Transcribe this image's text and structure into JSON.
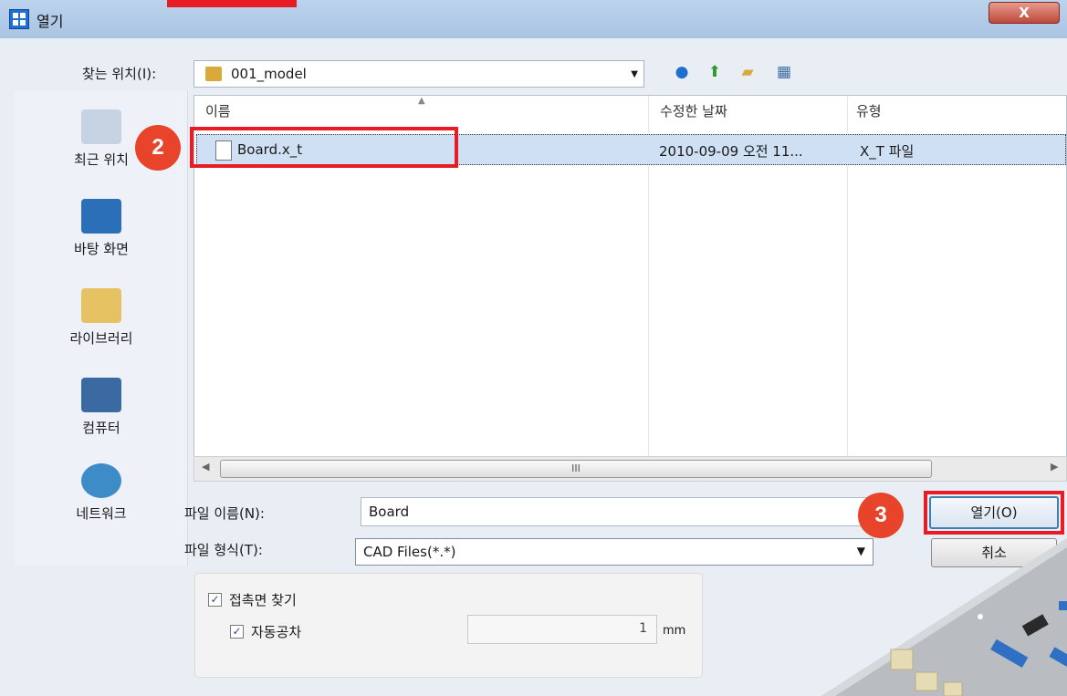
{
  "window": {
    "title": "열기",
    "close_label": "X"
  },
  "lookin": {
    "label": "찾는 위치(I):",
    "value": "001_model"
  },
  "places": [
    {
      "label": "최근 위치"
    },
    {
      "label": "바탕 화면"
    },
    {
      "label": "라이브러리"
    },
    {
      "label": "컴퓨터"
    },
    {
      "label": "네트워크"
    }
  ],
  "columns": {
    "name": "이름",
    "date": "수정한 날짜",
    "type": "유형"
  },
  "files": [
    {
      "name": "Board.x_t",
      "date": "2010-09-09 오전 11...",
      "type": "X_T 파일"
    }
  ],
  "scroll_thumb": "III",
  "filename": {
    "label": "파일 이름(N):",
    "value": "Board"
  },
  "filetype": {
    "label": "파일 형식(T):",
    "value": "CAD Files(*.*)"
  },
  "buttons": {
    "open": "열기(O)",
    "cancel": "취소"
  },
  "options": {
    "contact_label": "접촉면 찾기",
    "auto_tol_label": "자동공차",
    "tol_value": "1",
    "tol_unit": "mm"
  },
  "annotations": {
    "badge2": "2",
    "badge3": "3"
  },
  "colors": {
    "accent": "#e81c24",
    "badge": "#e8432b",
    "selection": "#cfe0f5"
  }
}
